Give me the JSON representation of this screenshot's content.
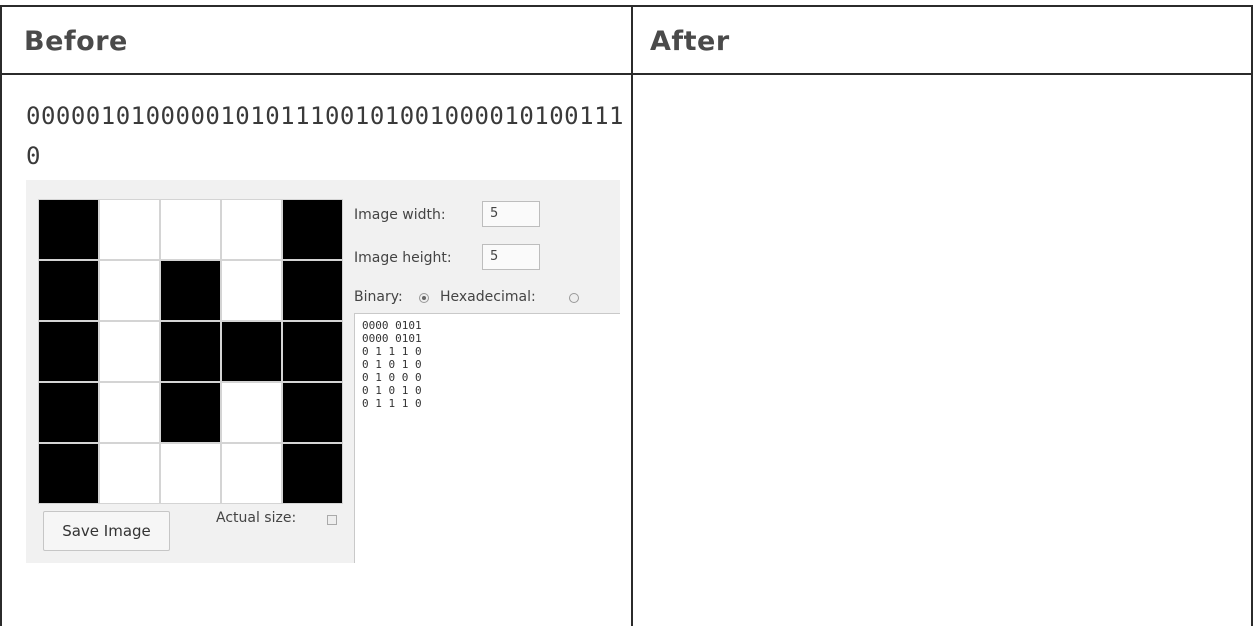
{
  "table": {
    "before_header": "Before",
    "after_header": "After",
    "binary_text": "00000101000001010111001010010000101001110"
  },
  "editor": {
    "pixels": [
      [
        1,
        0,
        0,
        0,
        1
      ],
      [
        1,
        0,
        1,
        0,
        1
      ],
      [
        1,
        0,
        1,
        1,
        1
      ],
      [
        1,
        0,
        1,
        0,
        1
      ],
      [
        1,
        0,
        0,
        0,
        1
      ]
    ],
    "width_label": "Image width:",
    "width_value": "5",
    "height_label": "Image height:",
    "height_value": "5",
    "binary_label": "Binary:",
    "binary_selected": true,
    "hex_label": "Hexadecimal:",
    "hex_selected": false,
    "output_lines": [
      "0000 0101",
      "0000 0101",
      "0 1 1 1 0",
      "0 1 0 1 0",
      "0 1 0 0 0",
      "0 1 0 1 0",
      "0 1 1 1 0"
    ],
    "save_label": "Save Image",
    "actual_size_label": "Actual size:",
    "actual_size_checked": false
  }
}
